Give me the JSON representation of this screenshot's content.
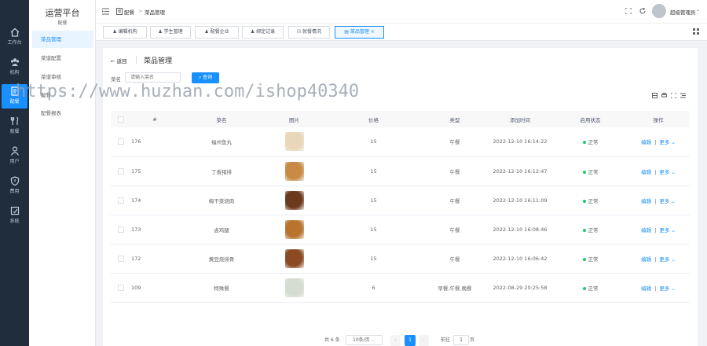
{
  "rail": [
    {
      "icon": "home-icon",
      "label": "工作台"
    },
    {
      "icon": "org-icon",
      "label": "机构"
    },
    {
      "icon": "meal-config-icon",
      "label": "配餐"
    },
    {
      "icon": "dining-icon",
      "label": "就餐"
    },
    {
      "icon": "user-icon",
      "label": "用户"
    },
    {
      "icon": "shield-icon",
      "label": "费用"
    },
    {
      "icon": "system-icon",
      "label": "系统"
    }
  ],
  "brand": {
    "title": "运营平台",
    "subtitle": "配餐"
  },
  "menu": [
    "菜品管理",
    "菜谱配置",
    "菜谱审核",
    "配餐",
    "配餐报表"
  ],
  "topbar": {
    "breadcrumb_root": "配餐",
    "breadcrumb_sep": ">",
    "breadcrumb_current": "菜品管理",
    "user": "超级管理员"
  },
  "tabs": [
    {
      "label": "编辑机构",
      "icon": "user-icon"
    },
    {
      "label": "学生管理",
      "icon": "user-icon"
    },
    {
      "label": "配餐企业",
      "icon": "user-icon"
    },
    {
      "label": "绑定记录",
      "icon": "user-icon"
    },
    {
      "label": "就餐情况",
      "icon": "dining-icon"
    },
    {
      "label": "菜品管理",
      "icon": "doc-icon",
      "close": "×"
    }
  ],
  "page": {
    "back": "返回",
    "title": "菜品管理"
  },
  "search": {
    "label": "菜名",
    "placeholder": "请输入菜名",
    "button": "查询"
  },
  "watermark": "https://www.huzhan.com/ishop40340",
  "table": {
    "headers": [
      "#",
      "菜名",
      "图片",
      "价格",
      "类型",
      "添加时间",
      "启用状态",
      "操作"
    ],
    "rows": [
      {
        "id": "176",
        "name": "福州鱼丸",
        "price": "15",
        "type": "午餐",
        "time": "2022-12-10 16:14:22",
        "status": "正常",
        "color": "#e8d7b8"
      },
      {
        "id": "175",
        "name": "丁香猪排",
        "price": "15",
        "type": "午餐",
        "time": "2022-12-10 16:12:47",
        "status": "正常",
        "color": "#c98a45"
      },
      {
        "id": "174",
        "name": "梅干菜烧肉",
        "price": "15",
        "type": "午餐",
        "time": "2022-12-10 16:11:09",
        "status": "正常",
        "color": "#6b3a1e"
      },
      {
        "id": "173",
        "name": "卤鸡腿",
        "price": "15",
        "type": "午餐",
        "time": "2022-12-10 16:08:46",
        "status": "正常",
        "color": "#b8742e"
      },
      {
        "id": "172",
        "name": "黄豆烧排骨",
        "price": "15",
        "type": "午餐",
        "time": "2022-12-10 16:06:42",
        "status": "正常",
        "color": "#8a4a22"
      },
      {
        "id": "109",
        "name": "特殊餐",
        "price": "6",
        "type": "早餐,午餐,晚餐",
        "time": "2022-08-29 20:25:58",
        "status": "正常",
        "color": "#d4ddd0"
      }
    ],
    "edit": "编辑",
    "more": "更多"
  },
  "pagination": {
    "total": "共 6 条",
    "size": "10条/页",
    "page": "1",
    "goto": "前往",
    "goto_value": "1",
    "page_unit": "页"
  }
}
